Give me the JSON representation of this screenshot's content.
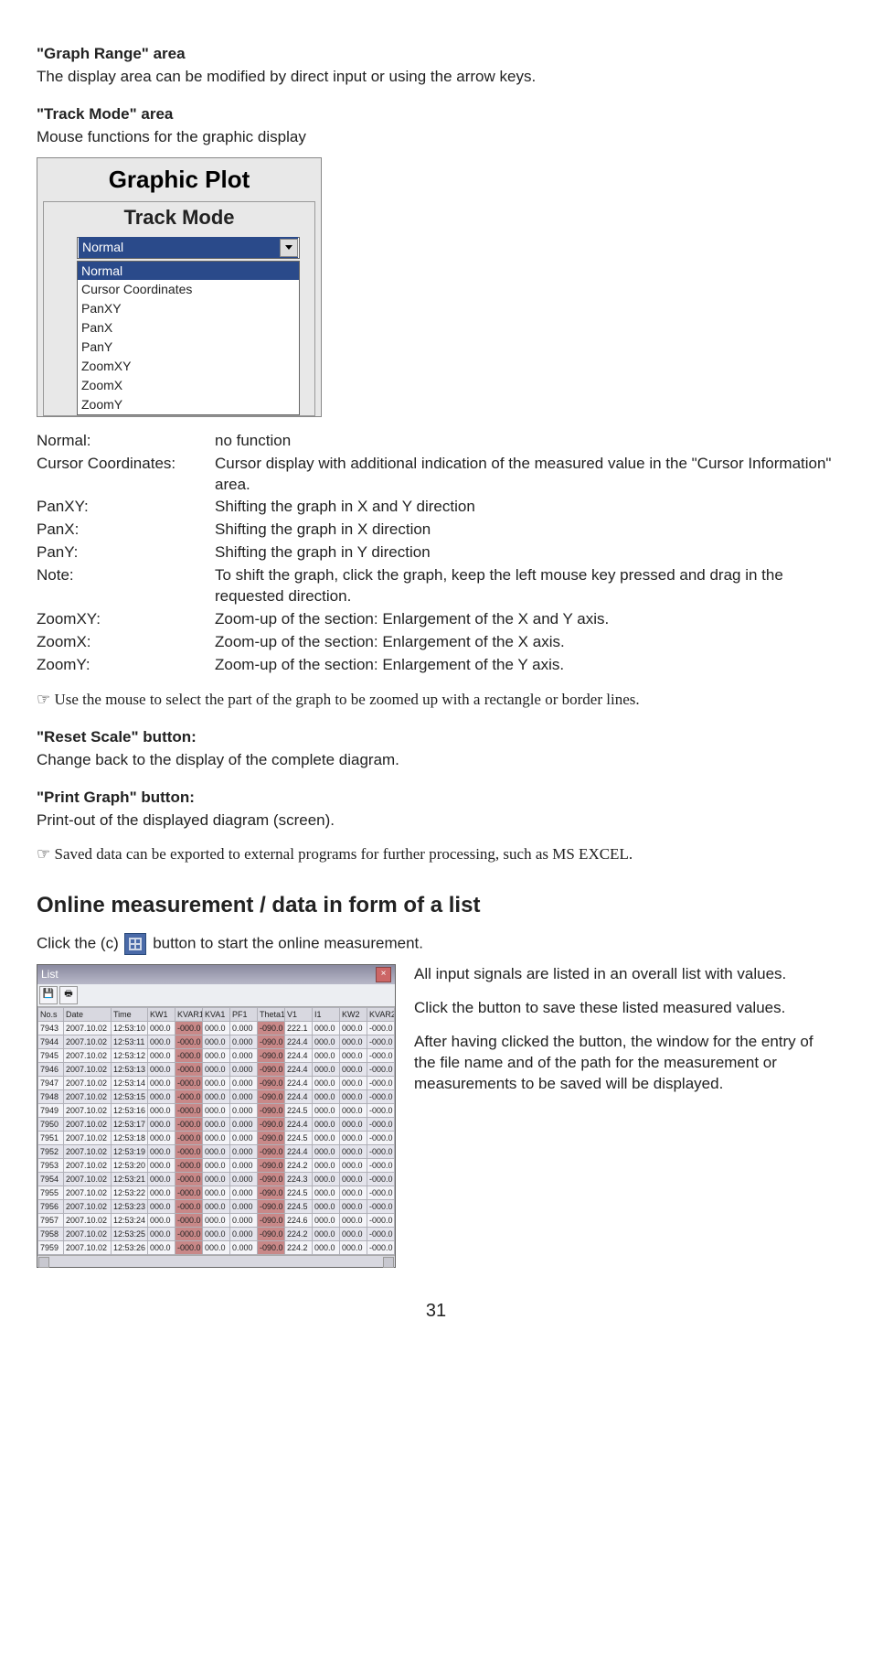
{
  "s1": {
    "title": "\"Graph Range\" area",
    "desc": "The display area can be modified by direct input or using the arrow keys."
  },
  "s2": {
    "title": "\"Track Mode\" area",
    "desc": "Mouse functions for the graphic display"
  },
  "gp": {
    "title": "Graphic Plot",
    "sub": "Track Mode",
    "selected": "Normal",
    "options": [
      "Normal",
      "Cursor Coordinates",
      "PanXY",
      "PanX",
      "PanY",
      "ZoomXY",
      "ZoomX",
      "ZoomY"
    ]
  },
  "defs": [
    {
      "term": "Normal:",
      "desc": "no function"
    },
    {
      "term": "Cursor Coordinates:",
      "desc": "Cursor display with additional indication of the measured value in the \"Cursor Information\" area."
    },
    {
      "term": "PanXY:",
      "desc": "Shifting the graph in X and Y direction"
    },
    {
      "term": "PanX:",
      "desc": "Shifting the graph in X direction"
    },
    {
      "term": "PanY:",
      "desc": "Shifting the graph in Y direction"
    },
    {
      "term": "Note:",
      "desc": "To shift the graph, click the graph, keep the left mouse key pressed and drag in the requested direction."
    },
    {
      "term": "ZoomXY:",
      "desc": "Zoom-up of the section: Enlargement of the X and Y axis."
    },
    {
      "term": "ZoomX:",
      "desc": "Zoom-up of the section: Enlargement of the X axis."
    },
    {
      "term": "ZoomY:",
      "desc": "Zoom-up of the section: Enlargement of the Y axis."
    }
  ],
  "p1": "☞ Use the mouse to select the part of the graph to be zoomed up with a rectangle or border lines.",
  "s3": {
    "title": "\"Reset Scale\" button:",
    "desc": "Change back to the display of the complete diagram."
  },
  "s4": {
    "title": "\"Print Graph\" button:",
    "desc": "Print-out of the displayed diagram (screen)."
  },
  "p2": "☞ Saved data can be exported to external programs for further processing, such as MS EXCEL.",
  "h2": "Online measurement / data in form of a list",
  "click": {
    "pre": "Click the (c) ",
    "post": " button to start the online measurement."
  },
  "side": {
    "p1": "All input signals are listed in an overall list with values.",
    "p2": "Click the  button to save these listed measured values.",
    "p3": "After having clicked the button, the window for the entry of the file name and of the path for the measurement or measurements to be saved will be displayed."
  },
  "listwin": {
    "title": "List",
    "headers": [
      "No.s",
      "Date",
      "Time",
      "KW1",
      "KVAR1",
      "KVA1",
      "PF1",
      "Theta1",
      "V1",
      "I1",
      "KW2",
      "KVAR2"
    ],
    "rows": [
      {
        "no": "7943",
        "date": "2007.10.02",
        "time": "12:53:10",
        "c": [
          "000.0",
          "-000.0",
          "000.0",
          "0.000",
          "-090.0",
          "222.1",
          "000.0",
          "000.0",
          "-000.0"
        ]
      },
      {
        "no": "7944",
        "date": "2007.10.02",
        "time": "12:53:11",
        "c": [
          "000.0",
          "-000.0",
          "000.0",
          "0.000",
          "-090.0",
          "224.4",
          "000.0",
          "000.0",
          "-000.0"
        ]
      },
      {
        "no": "7945",
        "date": "2007.10.02",
        "time": "12:53:12",
        "c": [
          "000.0",
          "-000.0",
          "000.0",
          "0.000",
          "-090.0",
          "224.4",
          "000.0",
          "000.0",
          "-000.0"
        ]
      },
      {
        "no": "7946",
        "date": "2007.10.02",
        "time": "12:53:13",
        "c": [
          "000.0",
          "-000.0",
          "000.0",
          "0.000",
          "-090.0",
          "224.4",
          "000.0",
          "000.0",
          "-000.0"
        ]
      },
      {
        "no": "7947",
        "date": "2007.10.02",
        "time": "12:53:14",
        "c": [
          "000.0",
          "-000.0",
          "000.0",
          "0.000",
          "-090.0",
          "224.4",
          "000.0",
          "000.0",
          "-000.0"
        ]
      },
      {
        "no": "7948",
        "date": "2007.10.02",
        "time": "12:53:15",
        "c": [
          "000.0",
          "-000.0",
          "000.0",
          "0.000",
          "-090.0",
          "224.4",
          "000.0",
          "000.0",
          "-000.0"
        ]
      },
      {
        "no": "7949",
        "date": "2007.10.02",
        "time": "12:53:16",
        "c": [
          "000.0",
          "-000.0",
          "000.0",
          "0.000",
          "-090.0",
          "224.5",
          "000.0",
          "000.0",
          "-000.0"
        ]
      },
      {
        "no": "7950",
        "date": "2007.10.02",
        "time": "12:53:17",
        "c": [
          "000.0",
          "-000.0",
          "000.0",
          "0.000",
          "-090.0",
          "224.4",
          "000.0",
          "000.0",
          "-000.0"
        ]
      },
      {
        "no": "7951",
        "date": "2007.10.02",
        "time": "12:53:18",
        "c": [
          "000.0",
          "-000.0",
          "000.0",
          "0.000",
          "-090.0",
          "224.5",
          "000.0",
          "000.0",
          "-000.0"
        ]
      },
      {
        "no": "7952",
        "date": "2007.10.02",
        "time": "12:53:19",
        "c": [
          "000.0",
          "-000.0",
          "000.0",
          "0.000",
          "-090.0",
          "224.4",
          "000.0",
          "000.0",
          "-000.0"
        ]
      },
      {
        "no": "7953",
        "date": "2007.10.02",
        "time": "12:53:20",
        "c": [
          "000.0",
          "-000.0",
          "000.0",
          "0.000",
          "-090.0",
          "224.2",
          "000.0",
          "000.0",
          "-000.0"
        ]
      },
      {
        "no": "7954",
        "date": "2007.10.02",
        "time": "12:53:21",
        "c": [
          "000.0",
          "-000.0",
          "000.0",
          "0.000",
          "-090.0",
          "224.3",
          "000.0",
          "000.0",
          "-000.0"
        ]
      },
      {
        "no": "7955",
        "date": "2007.10.02",
        "time": "12:53:22",
        "c": [
          "000.0",
          "-000.0",
          "000.0",
          "0.000",
          "-090.0",
          "224.5",
          "000.0",
          "000.0",
          "-000.0"
        ]
      },
      {
        "no": "7956",
        "date": "2007.10.02",
        "time": "12:53:23",
        "c": [
          "000.0",
          "-000.0",
          "000.0",
          "0.000",
          "-090.0",
          "224.5",
          "000.0",
          "000.0",
          "-000.0"
        ]
      },
      {
        "no": "7957",
        "date": "2007.10.02",
        "time": "12:53:24",
        "c": [
          "000.0",
          "-000.0",
          "000.0",
          "0.000",
          "-090.0",
          "224.6",
          "000.0",
          "000.0",
          "-000.0"
        ]
      },
      {
        "no": "7958",
        "date": "2007.10.02",
        "time": "12:53:25",
        "c": [
          "000.0",
          "-000.0",
          "000.0",
          "0.000",
          "-090.0",
          "224.2",
          "000.0",
          "000.0",
          "-000.0"
        ]
      },
      {
        "no": "7959",
        "date": "2007.10.02",
        "time": "12:53:26",
        "c": [
          "000.0",
          "-000.0",
          "000.0",
          "0.000",
          "-090.0",
          "224.2",
          "000.0",
          "000.0",
          "-000.0"
        ]
      }
    ]
  },
  "pagenum": "31"
}
